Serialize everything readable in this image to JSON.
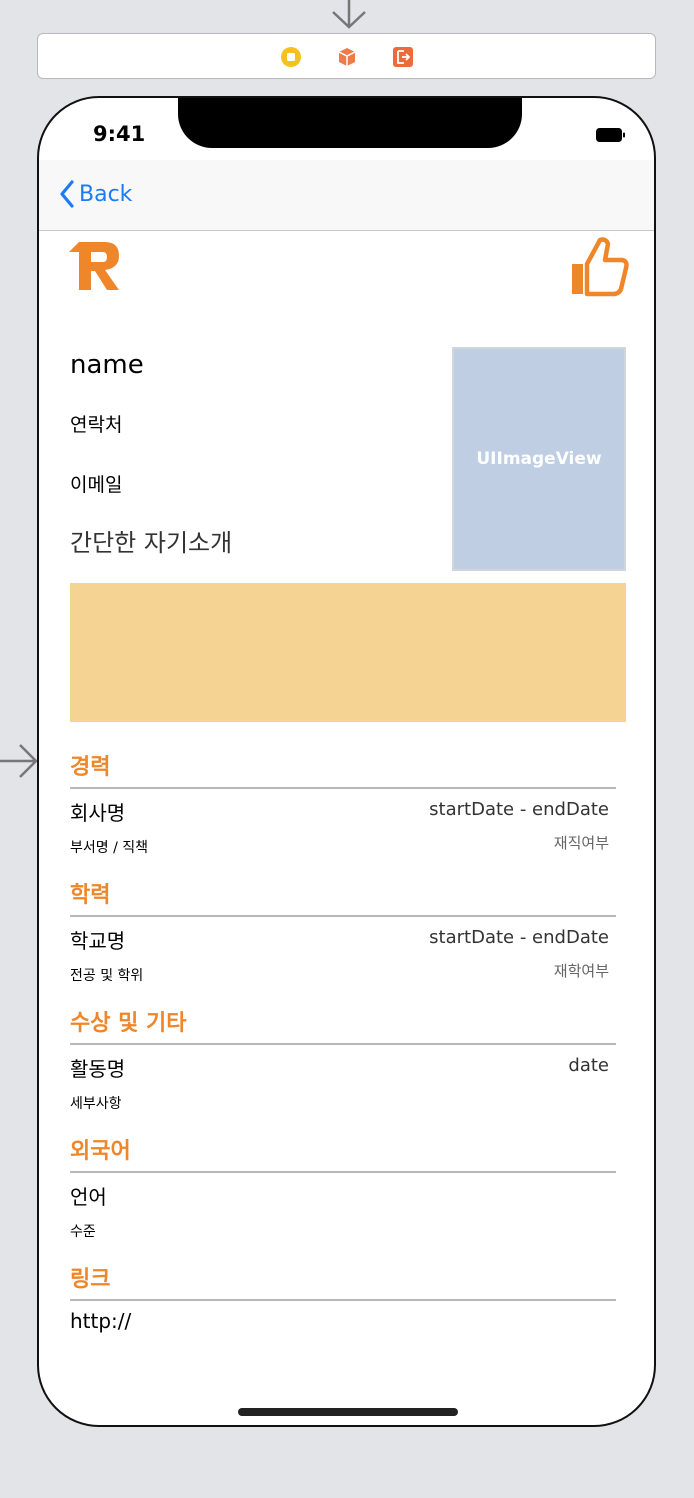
{
  "status_bar": {
    "time": "9:41"
  },
  "nav": {
    "back_label": "Back"
  },
  "profile": {
    "name": "name",
    "contact": "연락처",
    "email": "이메일",
    "intro": "간단한 자기소개",
    "image_label": "UIImageView"
  },
  "sections": {
    "career": {
      "title": "경력",
      "company": "회사명",
      "dates": "startDate - endDate",
      "dept": "부서명 / 직책",
      "status": "재직여부"
    },
    "education": {
      "title": "학력",
      "school": "학교명",
      "dates": "startDate - endDate",
      "major": "전공 및 학위",
      "status": "재학여부"
    },
    "awards": {
      "title": "수상 및 기타",
      "activity": "활동명",
      "date": "date",
      "detail": "세부사항"
    },
    "language": {
      "title": "외국어",
      "lang": "언어",
      "level": "수준"
    },
    "links": {
      "title": "링크",
      "url": "http://"
    }
  },
  "colors": {
    "accent": "#ef8629",
    "link_blue": "#1a7cf5",
    "image_bg": "#bfcee3",
    "intro_bg": "#f5d392"
  },
  "icons": [
    "arrow-down-icon",
    "arrow-right-icon",
    "view-controller-icon",
    "first-responder-icon",
    "exit-icon",
    "back-chevron-icon",
    "logo-r-icon",
    "thumbs-up-icon",
    "battery-icon"
  ]
}
